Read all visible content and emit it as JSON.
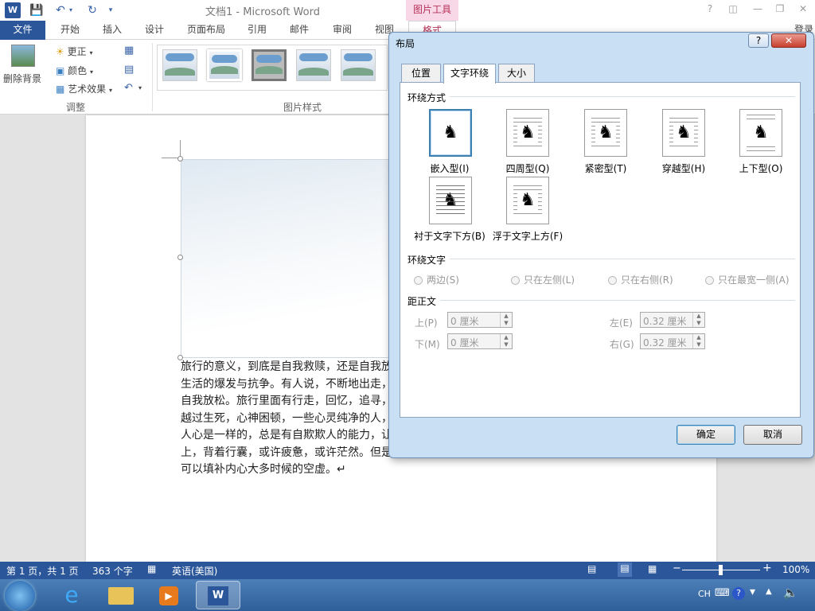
{
  "app": {
    "title": "文档1 - Microsoft Word",
    "context_tab": "图片工具",
    "account": "登录",
    "help": "?"
  },
  "ribbon_tabs": [
    "文件",
    "开始",
    "插入",
    "设计",
    "页面布局",
    "引用",
    "邮件",
    "审阅",
    "视图"
  ],
  "format_tab": "格式",
  "ribbon": {
    "remove_bg": "删除背景",
    "correct": "更正",
    "color": "颜色",
    "art_effect": "艺术效果",
    "adjust_group": "调整",
    "styles_group": "图片样式"
  },
  "doc": {
    "text": "旅行的意义，到底是自我救赎，还是自我放逐，还是逃离现实的尘嚣让一切归零。是一种对生活的爆发与抗争。有人说，不断地出走，只是想要把自己放在里面，更多的时候，也算是自我放松。旅行里面有行走，回忆，追寻，忘记，书写等等成分。走到荒芜的世界尽头。穿越过生死，心神困顿，一些心灵纯净的人，一些或许这次不做就无法再完成的事。风景就和人心是一样的，总是有自欺欺人的能力，让我们偏爱，并且舍不得放开。我们自己走在路上，背着行囊，或许疲惫，或许茫然。但是那些储存在干净离得风景和回忆是不会变的。它可以填补内心大多时候的空虚。↵",
    "end_mark": "↵"
  },
  "status": {
    "page": "第 1 页，共 1 页",
    "words": "363 个字",
    "lang": "英语(美国)",
    "zoom": "100%",
    "zoom_fraction": 0.5
  },
  "taskbar": {
    "ime": "CH"
  },
  "dialog": {
    "title": "布局",
    "help": "?",
    "close": "✕",
    "tabs": [
      "位置",
      "文字环绕",
      "大小"
    ],
    "active_tab": 1,
    "wrap_section": "环绕方式",
    "wrap_options": [
      "嵌入型(I)",
      "四周型(Q)",
      "紧密型(T)",
      "穿越型(H)",
      "上下型(O)",
      "衬于文字下方(B)",
      "浮于文字上方(F)"
    ],
    "wrap_text_section": "环绕文字",
    "wrap_text_options": [
      "两边(S)",
      "只在左侧(L)",
      "只在右侧(R)",
      "只在最宽一侧(A)"
    ],
    "distance_section": "距正文",
    "distance": {
      "top_label": "上(P)",
      "top_value": "0 厘米",
      "bottom_label": "下(M)",
      "bottom_value": "0 厘米",
      "left_label": "左(E)",
      "left_value": "0.32 厘米",
      "right_label": "右(G)",
      "right_value": "0.32 厘米"
    },
    "ok": "确定",
    "cancel": "取消"
  }
}
